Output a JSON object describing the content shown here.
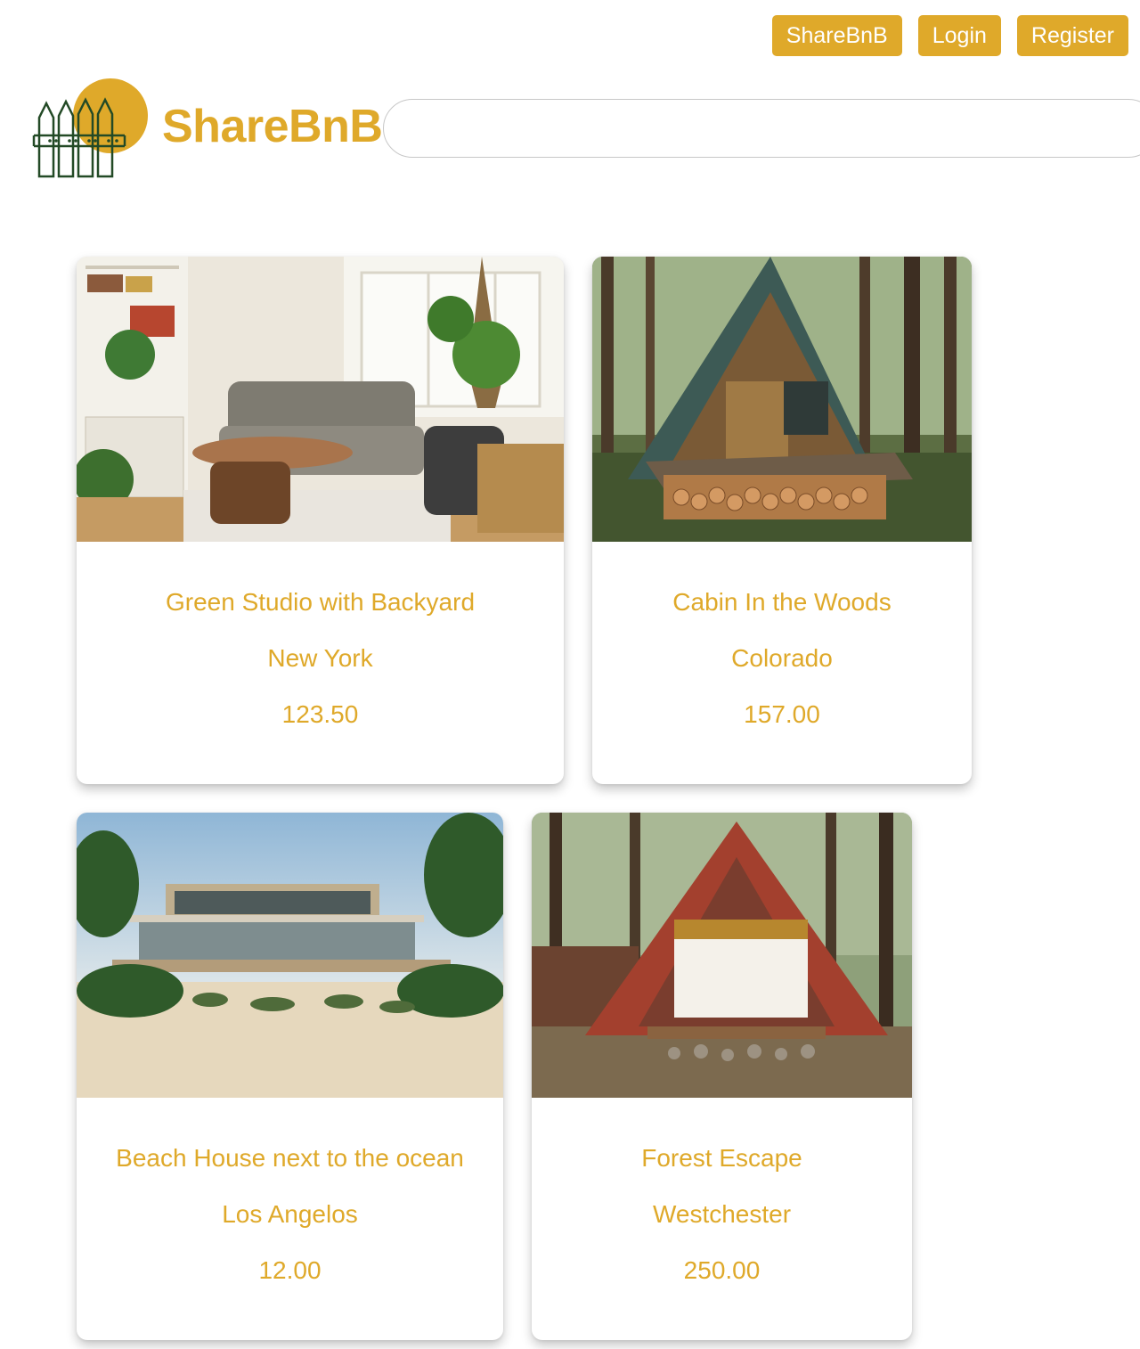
{
  "nav": {
    "buttons": [
      {
        "label": "ShareBnB"
      },
      {
        "label": "Login"
      },
      {
        "label": "Register"
      }
    ]
  },
  "brand": {
    "name": "ShareBnB",
    "accent_color": "#dfa92a",
    "logo_icon": "fence-sun-logo-icon"
  },
  "search": {
    "value": "",
    "placeholder": ""
  },
  "listings": [
    {
      "title": "Green Studio with Backyard",
      "location": "New York",
      "price": "123.50",
      "image": "living-room-photo"
    },
    {
      "title": "Cabin In the Woods",
      "location": "Colorado",
      "price": "157.00",
      "image": "a-frame-cabin-photo"
    },
    {
      "title": "Beach House next to the ocean",
      "location": "Los Angelos",
      "price": "12.00",
      "image": "beach-house-photo"
    },
    {
      "title": "Forest Escape",
      "location": "Westchester",
      "price": "250.00",
      "image": "red-a-frame-photo"
    }
  ]
}
